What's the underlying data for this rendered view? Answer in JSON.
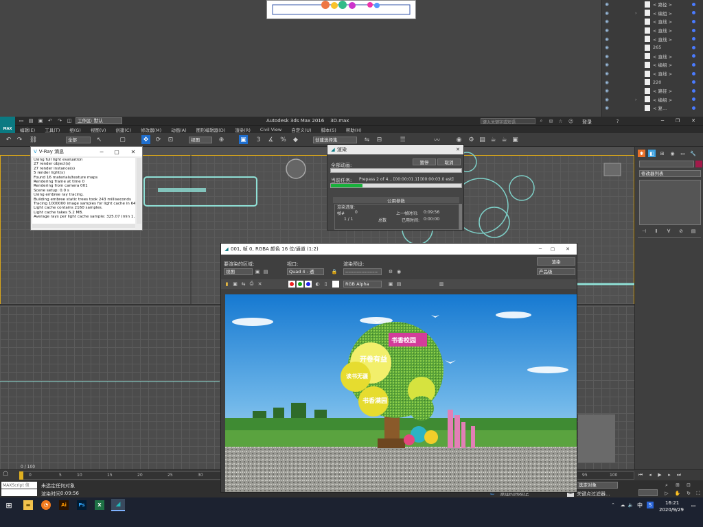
{
  "top_layers": {
    "rows": [
      {
        "label": "< 路径 >",
        "arrow": ""
      },
      {
        "label": "< 编组 >",
        "arrow": ">"
      },
      {
        "label": "< 直线 >",
        "arrow": ""
      },
      {
        "label": "< 直线 >",
        "arrow": ""
      },
      {
        "label": "< 直线 >",
        "arrow": ""
      },
      {
        "label": "265",
        "arrow": ""
      },
      {
        "label": "< 直线 >",
        "arrow": ""
      },
      {
        "label": "< 编组 >",
        "arrow": ""
      },
      {
        "label": "< 直线 >",
        "arrow": ""
      },
      {
        "label": "220",
        "arrow": ""
      },
      {
        "label": "< 路径 >",
        "arrow": ""
      },
      {
        "label": "< 编组 >",
        "arrow": ">"
      },
      {
        "label": "< 复...",
        "arrow": ""
      }
    ]
  },
  "app": {
    "logo": "MAX",
    "workspace_label": "工作区: 默认",
    "title": "Autodesk 3ds Max 2016",
    "file": "3D.max",
    "search_placeholder": "键入关键字或短语",
    "login": "登录"
  },
  "menu": [
    "编辑(E)",
    "工具(T)",
    "组(G)",
    "视图(V)",
    "创建(C)",
    "修改器(M)",
    "动画(A)",
    "图形编辑器(D)",
    "渲染(R)",
    "Civil View",
    "自定义(U)",
    "脚本(S)",
    "帮助(H)"
  ],
  "toolbar": {
    "filter": "全部",
    "view": "视图",
    "selection_set": "创建选择集"
  },
  "vray_log": {
    "title": "V-Ray 消息",
    "lines": [
      "Using full light evaluation",
      "27 render object(s)",
      "27 render instance(s)",
      "5 render light(s)",
      "Found 16 materials/texture maps",
      "Rendering frame at time 0",
      "Rendering from camera 001",
      "Scene setup: 0.0 s",
      "Using embree ray tracing.",
      "Building embree static trees took 243 milliseconds",
      "Tracing 1000000 image samples for light cache in 64 passes",
      "Light cache contains 2160 samples.",
      "Light cache takes 5.2 MB.",
      "Average rays per light cache sample: 325.07 (min 1, max 21"
    ]
  },
  "render_dialog": {
    "title": "渲染",
    "pause": "暂停",
    "cancel": "取消",
    "total_label": "全部动画:",
    "current_label": "当前任务:",
    "current_value": "Prepass 2 of 4... [00:00:01.1] [00:00:03.0 est]",
    "progress_total": 0,
    "progress_current": 0.24,
    "section": "公用参数",
    "rendering_progress": "渲染进度:",
    "frame_label": "帧#",
    "frame_value": "0",
    "prev_frame_label": "上一帧时间:",
    "prev_frame_value": "0:09:56",
    "count": "1 / 1",
    "total_word": "总数",
    "elapsed_label": "已用时间:",
    "elapsed_value": "0:00:00"
  },
  "frame_buffer": {
    "title": "001, 帧 0, RGBA 颜色 16 位/通道 (1:2)",
    "area_label": "要渲染的区域:",
    "area_value": "视图",
    "viewport_label": "视口:",
    "viewport_value": "Quad 4 - 透",
    "preset_label": "渲染预设:",
    "preset_value": "--------------------",
    "render_button": "渲染",
    "quality_value": "产品级",
    "channel_value": "RGB Alpha",
    "scene_signs": [
      "书香校园",
      "开卷有益",
      "读书无疆",
      "书香满园"
    ]
  },
  "command_panel": {
    "modifier_list": "修改器列表"
  },
  "timeline": {
    "frame": "0 / 100",
    "ticks": [
      "0",
      "5",
      "10",
      "15",
      "20",
      "25",
      "30",
      "95",
      "100"
    ],
    "selection_label": "选定对象"
  },
  "status": {
    "script_label": "MAXScript 侦",
    "msg1": "未选定任何对象",
    "msg2_label": "渲染时间",
    "msg2_value": "0:09:56",
    "add_tag": "添加时间标记",
    "filter_label": "关键点过滤器..."
  },
  "taskbar": {
    "time": "16:21",
    "date": "2020/9/29",
    "lang": "中",
    "ime": "S"
  },
  "colors": {
    "accent": "#0b7a82",
    "progress_green": "#18b13b",
    "tb_blue": "#1f6fcf"
  }
}
